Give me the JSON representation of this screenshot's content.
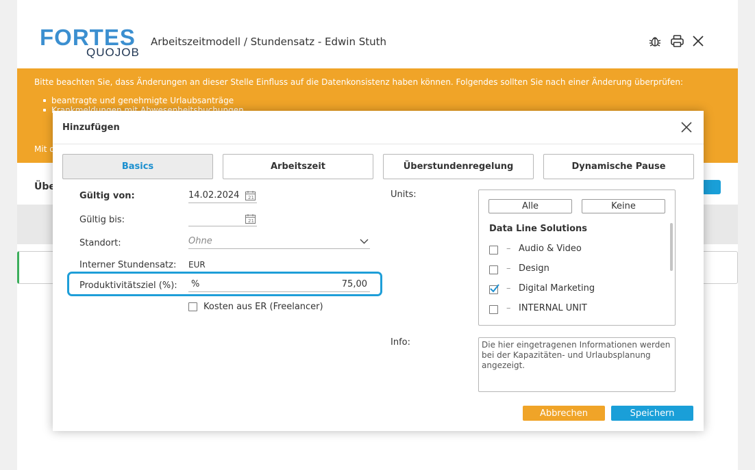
{
  "app": {
    "logo_primary": "FORTES",
    "logo_secondary": "QUOJOB",
    "page_title": "Arbeitszeitmodell / Stundensatz - Edwin Stuth",
    "header_icons": [
      "bug-icon",
      "printer-icon",
      "close-icon"
    ]
  },
  "banner": {
    "text": "Bitte beachten Sie, dass Änderungen an dieser Stelle Einfluss auf die Datenkonsistenz haben können. Folgendes sollten Sie nach einer Änderung überprüfen:",
    "items": [
      "beantragte und genehmigte Urlaubsanträge",
      "Krankmeldungen mit Abwesenheitsbuchungen"
    ],
    "footer_partial": "Mit d",
    "color": "#f0a428"
  },
  "background": {
    "partial_heading": "Übe"
  },
  "modal": {
    "title": "Hinzufügen",
    "tabs": [
      {
        "label": "Basics",
        "active": true
      },
      {
        "label": "Arbeitszeit",
        "active": false
      },
      {
        "label": "Überstundenregelung",
        "active": false
      },
      {
        "label": "Dynamische Pause",
        "active": false
      }
    ],
    "form": {
      "valid_from_label": "Gültig von:",
      "valid_from_value": "14.02.2024",
      "valid_to_label": "Gültig bis:",
      "valid_to_value": "",
      "location_label": "Standort:",
      "location_placeholder": "Ohne",
      "hourly_rate_label": "Interner Stundensatz:",
      "hourly_rate_currency": "EUR",
      "productivity_label": "Produktivitätsziel (%):",
      "productivity_unit": "%",
      "productivity_value": "75,00",
      "freelancer_label": "Kosten aus ER (Freelancer)",
      "freelancer_checked": false
    },
    "units": {
      "label": "Units:",
      "all_button": "Alle",
      "none_button": "Keine",
      "group": "Data Line Solutions",
      "items": [
        {
          "name": "Audio & Video",
          "checked": false
        },
        {
          "name": "Design",
          "checked": false
        },
        {
          "name": "Digital Marketing",
          "checked": true
        },
        {
          "name": "INTERNAL UNIT",
          "checked": false
        }
      ]
    },
    "info": {
      "label": "Info:",
      "placeholder": "Die hier eingetragenen Informationen werden bei der Kapazitäten- und Urlaubsplanung angezeigt."
    },
    "buttons": {
      "cancel": "Abbrechen",
      "save": "Speichern"
    }
  },
  "colors": {
    "accent_blue": "#1a9fd8",
    "accent_orange": "#f0a428",
    "highlight": "#1e9ed8"
  }
}
